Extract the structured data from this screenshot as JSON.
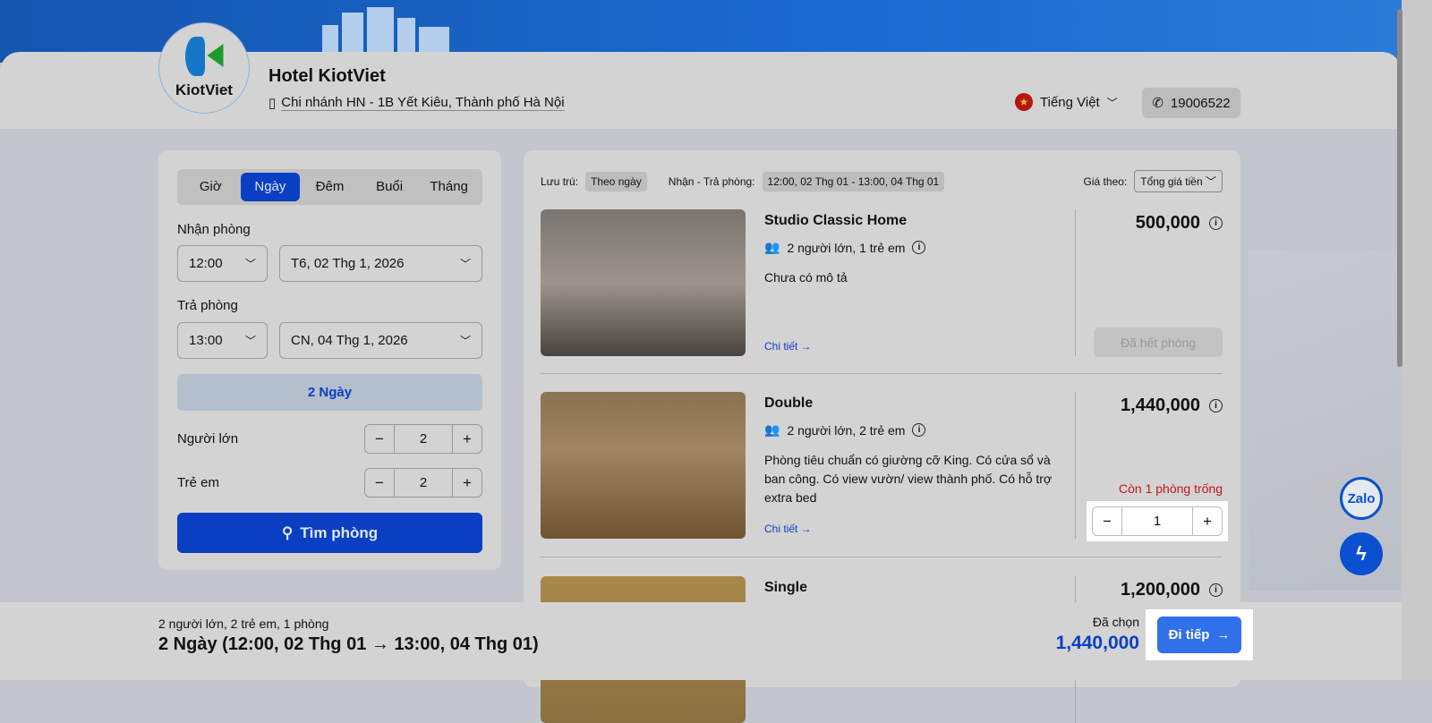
{
  "hotel": {
    "logo_text": "KiotViet",
    "name": "Hotel KiotViet",
    "branch": "Chi nhánh HN - 1B Yết Kiêu, Thành phố Hà Nội"
  },
  "header": {
    "language": "Tiếng Việt",
    "phone": "19006522"
  },
  "search": {
    "tabs": [
      "Giờ",
      "Ngày",
      "Đêm",
      "Buổi",
      "Tháng"
    ],
    "active_tab": "Ngày",
    "checkin_label": "Nhận phòng",
    "checkin_time": "12:00",
    "checkin_date": "T6, 02 Thg 1, 2026",
    "checkout_label": "Trả phòng",
    "checkout_time": "13:00",
    "checkout_date": "CN, 04 Thg 1, 2026",
    "duration": "2 Ngày",
    "adults_label": "Người lớn",
    "adults": "2",
    "children_label": "Trẻ em",
    "children": "2",
    "button": "Tìm phòng"
  },
  "filters": {
    "stay_label": "Lưu trú:",
    "stay_value": "Theo ngày",
    "dates_label": "Nhận - Trả phòng:",
    "dates_value": "12:00, 02 Thg 01 - 13:00, 04 Thg 01",
    "price_label": "Giá theo:",
    "price_value": "Tổng giá tiền"
  },
  "rooms": [
    {
      "name": "Studio Classic Home",
      "capacity": "2 người lớn, 1 trẻ em",
      "description": "Chưa có mô tả",
      "detail": "Chi tiết →",
      "price": "500,000",
      "status": "Đã hết phòng"
    },
    {
      "name": "Double",
      "capacity": "2 người lớn, 2 trẻ em",
      "description": "Phòng tiêu chuẩn có giường cỡ King. Có cửa sổ và ban công. Có view vườn/ view thành phố. Có hỗ trợ extra bed",
      "detail": "Chi tiết →",
      "price": "1,440,000",
      "availability": "Còn 1 phòng trống",
      "quantity": "1"
    },
    {
      "name": "Single",
      "price": "1,200,000"
    }
  ],
  "footer": {
    "summary": "2 người lớn, 2 trẻ em, 1 phòng",
    "dates": "2 Ngày (12:00, 02 Thg 01 → 13:00, 04 Thg 01)",
    "chosen_label": "Đã chọn",
    "total": "1,440,000",
    "next": "Đi tiếp"
  },
  "floating": {
    "zalo": "Zalo"
  }
}
